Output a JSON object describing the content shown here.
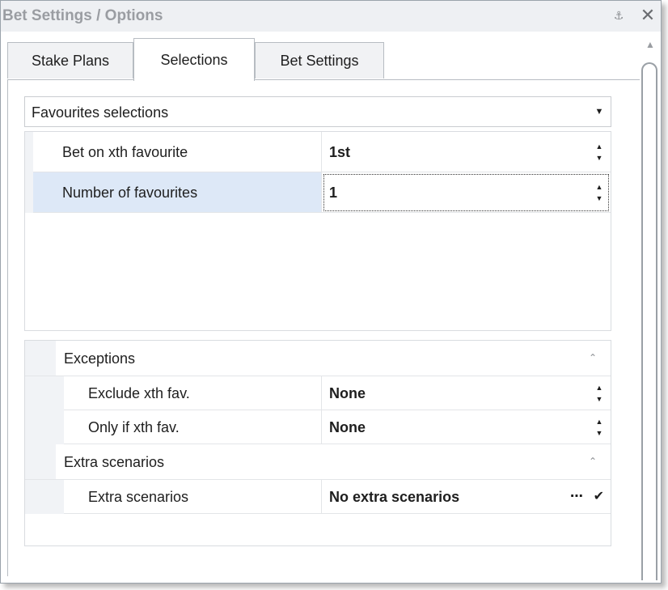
{
  "window": {
    "title": "Bet Settings / Options"
  },
  "tabs": [
    {
      "label": "Stake Plans",
      "active": false
    },
    {
      "label": "Selections",
      "active": true
    },
    {
      "label": "Bet Settings",
      "active": false
    }
  ],
  "selection_mode": {
    "value": "Favourites selections"
  },
  "properties": [
    {
      "label": "Bet on xth favourite",
      "value": "1st"
    },
    {
      "label": "Number of favourites",
      "value": "1",
      "selected": true
    }
  ],
  "groups": [
    {
      "label": "Exceptions",
      "items": [
        {
          "label": "Exclude xth fav.",
          "value": "None"
        },
        {
          "label": "Only if xth fav.",
          "value": "None"
        }
      ]
    },
    {
      "label": "Extra scenarios",
      "items": [
        {
          "label": "Extra scenarios",
          "value": "No extra scenarios"
        }
      ]
    }
  ],
  "icons": {
    "pin": "pin-icon",
    "close": "close-icon",
    "dropdown": "chevron-down-icon",
    "collapse": "chevron-up-icon",
    "spin": "spin-arrows-icon",
    "ellipsis": "ellipsis-icon",
    "check": "check-icon",
    "scroll_up": "scroll-up-icon"
  },
  "colors": {
    "selected_row": "#dde8f7",
    "gutter": "#f1f3f6",
    "title_text": "#9a9da2"
  }
}
